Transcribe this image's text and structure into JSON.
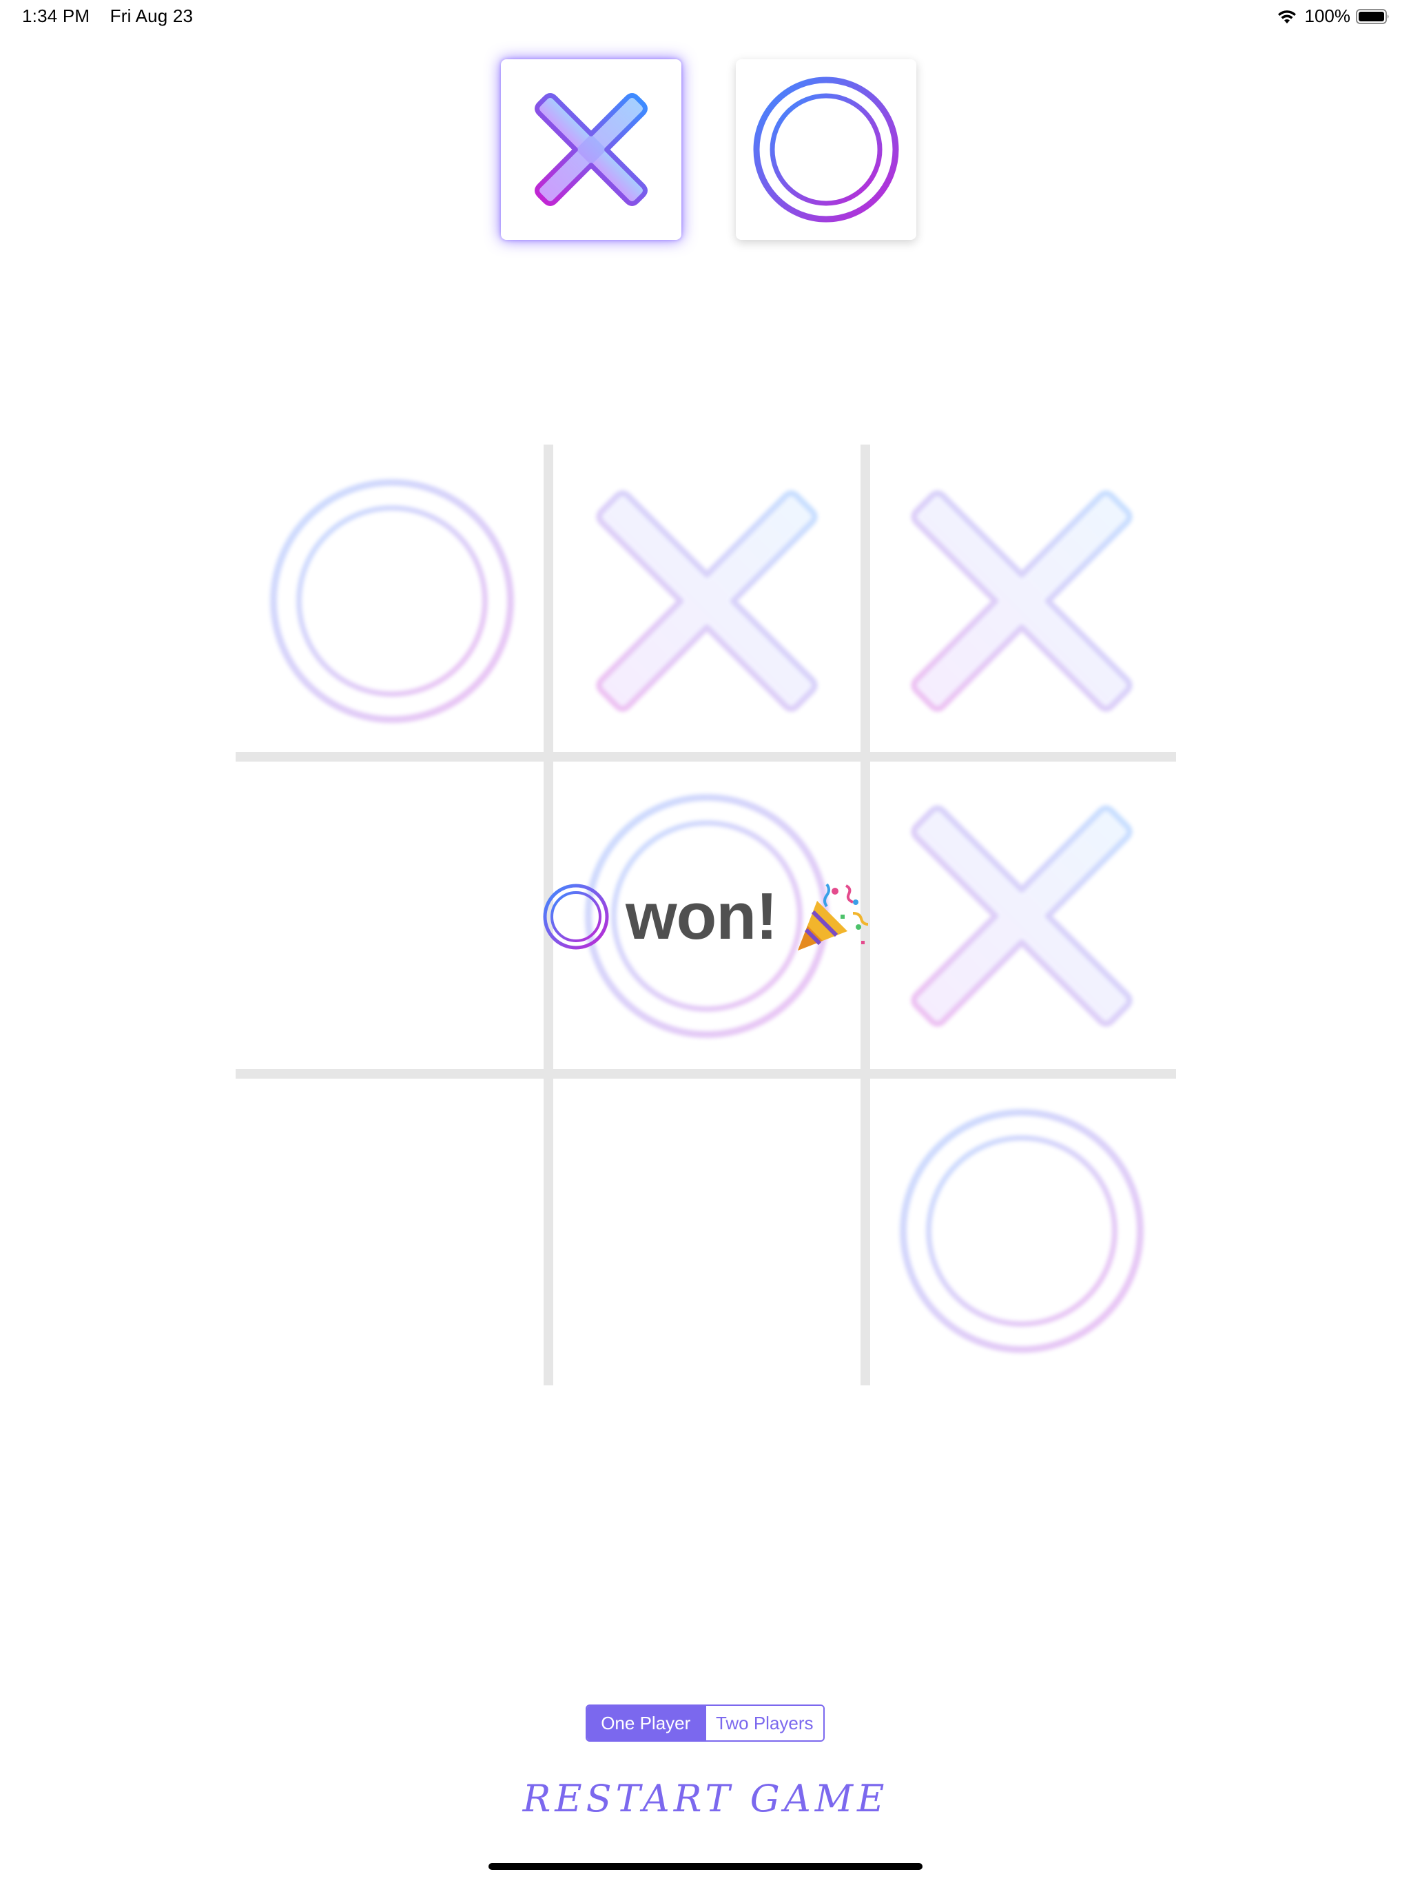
{
  "status_bar": {
    "time": "1:34 PM",
    "date": "Fri Aug 23",
    "battery_percent": "100%",
    "icons": [
      "wifi-icon",
      "battery-icon"
    ]
  },
  "player_tiles": [
    {
      "symbol": "X",
      "icon": "x-mark-icon",
      "active": true
    },
    {
      "symbol": "O",
      "icon": "o-mark-icon",
      "active": false
    }
  ],
  "board": {
    "cells": [
      [
        "O",
        "X",
        "X"
      ],
      [
        "",
        "O",
        "X"
      ],
      [
        "",
        "",
        "O"
      ]
    ],
    "faded": true
  },
  "winner": {
    "icon": "o-mark-icon",
    "text": "won!",
    "emoji_icon": "party-popper-icon"
  },
  "mode_selector": {
    "options": [
      "One Player",
      "Two Players"
    ],
    "selected": "One Player"
  },
  "restart_label": "Restart Game",
  "colors": {
    "accent": "#7b68ee",
    "gradient_start": "#3d8bff",
    "gradient_end": "#c026d3",
    "grid": "#e6e6e6",
    "winner_text": "#505050"
  }
}
